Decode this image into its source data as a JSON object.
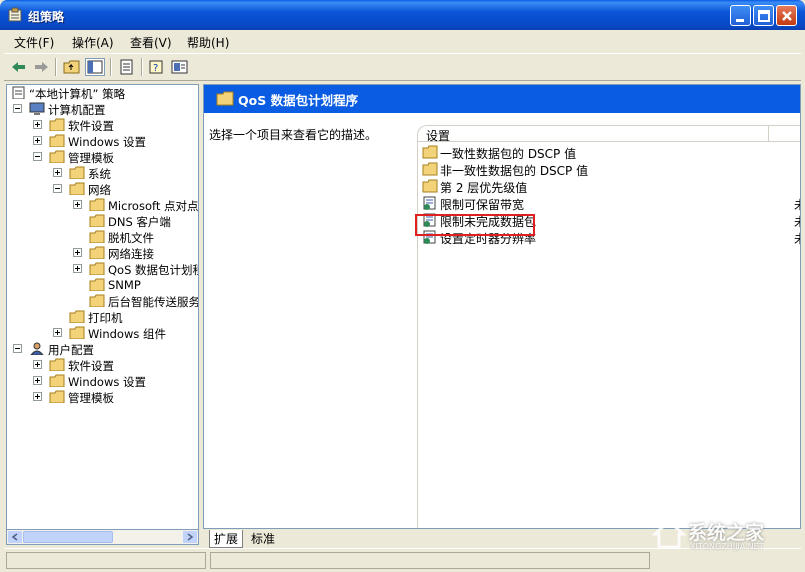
{
  "window": {
    "title": "组策略"
  },
  "menu": [
    "文件(F)",
    "操作(A)",
    "查看(V)",
    "帮助(H)"
  ],
  "toolbar": [
    "back-icon",
    "forward-icon",
    "up-icon",
    "show-hide-tree-icon",
    "export-list-icon",
    "help-icon",
    "properties-icon"
  ],
  "tree": {
    "root": "“本地计算机” 策略",
    "computer": "计算机配置",
    "c_software": "软件设置",
    "c_windows": "Windows 设置",
    "c_admin": "管理模板",
    "c_system": "系统",
    "c_network": "网络",
    "n_microsoft": "Microsoft 点对点",
    "n_dns": "DNS 客户端",
    "n_offline": "脱机文件",
    "n_netconn": "网络连接",
    "n_qos": "QoS 数据包计划程",
    "n_snmp": "SNMP",
    "n_bits": "后台智能传送服务",
    "c_printers": "打印机",
    "c_wincomp": "Windows 组件",
    "user": "用户配置",
    "u_software": "软件设置",
    "u_windows": "Windows 设置",
    "u_admin": "管理模板"
  },
  "right": {
    "header": "QoS 数据包计划程序",
    "description": "选择一个项目来查看它的描述。",
    "column": "设置",
    "items": [
      {
        "label": "一致性数据包的 DSCP 值",
        "type": "folder",
        "tail": ""
      },
      {
        "label": "非一致性数据包的 DSCP 值",
        "type": "folder",
        "tail": ""
      },
      {
        "label": "第 2 层优先级值",
        "type": "folder",
        "tail": ""
      },
      {
        "label": "限制可保留带宽",
        "type": "policy",
        "tail": "未"
      },
      {
        "label": "限制未完成数据包",
        "type": "policy",
        "tail": "未"
      },
      {
        "label": "设置定时器分辨率",
        "type": "policy",
        "tail": "未"
      }
    ]
  },
  "tabs": [
    "扩展",
    "标准"
  ],
  "watermark": {
    "text": "系统之家",
    "url": "XITONGZHIJIA.NET"
  }
}
